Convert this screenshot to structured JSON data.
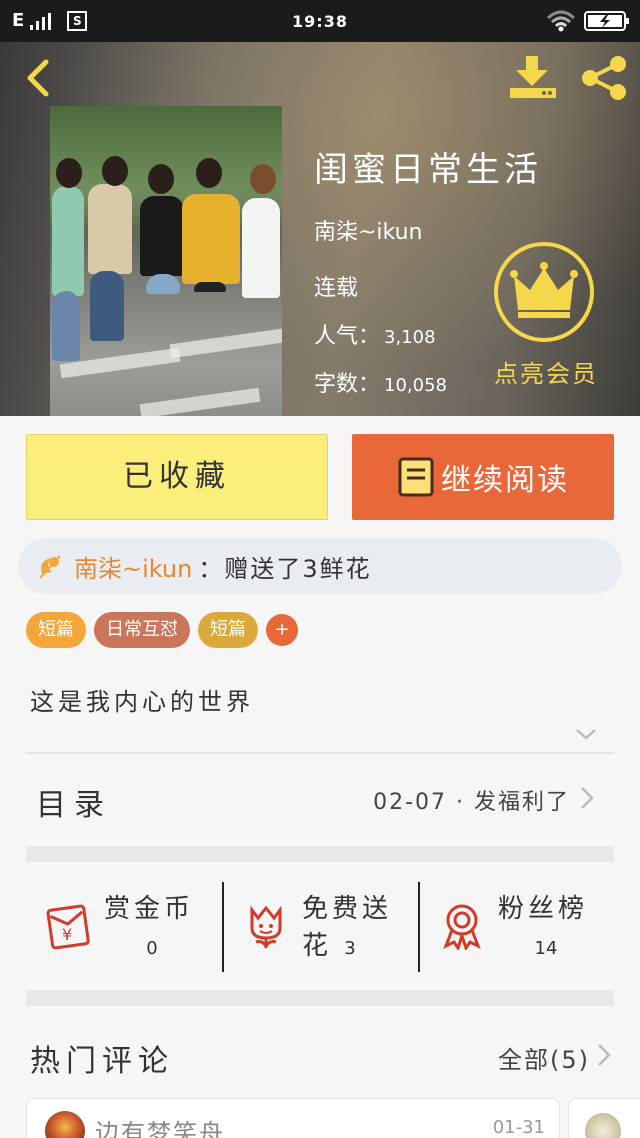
{
  "status_bar": {
    "network": "E",
    "sim_icon": "S",
    "time": "19:38"
  },
  "book": {
    "title": "闺蜜日常生活",
    "author": "南柒~ikun",
    "status": "连载",
    "popularity_label": "人气：",
    "popularity_value": "3,108",
    "words_label": "字数：",
    "words_value": "10,058"
  },
  "vip": {
    "label": "点亮会员",
    "color": "#f4d74a"
  },
  "actions": {
    "favorite_label": "已收藏",
    "read_label": "继续阅读"
  },
  "gift": {
    "user": "南柒~ikun",
    "text": "：赠送了3鲜花"
  },
  "tags": [
    {
      "label": "短篇",
      "color": "#f3a63a"
    },
    {
      "label": "日常互怼",
      "color": "#c9765b"
    },
    {
      "label": "短篇",
      "color": "#d9a93a"
    }
  ],
  "tag_add_label": "+",
  "intro": "这是我内心的世界",
  "toc": {
    "title": "目录",
    "latest": "02-07 · 发福利了"
  },
  "stats": [
    {
      "label": "赏金币",
      "value": "0",
      "icon": "red-envelope-icon"
    },
    {
      "label": "免费送花",
      "value": "3",
      "icon": "flower-icon"
    },
    {
      "label": "粉丝榜",
      "value": "14",
      "icon": "medal-icon"
    }
  ],
  "hot_comments": {
    "title": "热门评论",
    "all_label": "全部(5)",
    "first": {
      "name": "边有梦笑舟",
      "date": "01-31"
    }
  },
  "colors": {
    "accent_orange": "#e9683a",
    "favorite_yellow": "#fbee7a",
    "gift_user": "#e9872f",
    "icon_red": "#d23a2a"
  }
}
